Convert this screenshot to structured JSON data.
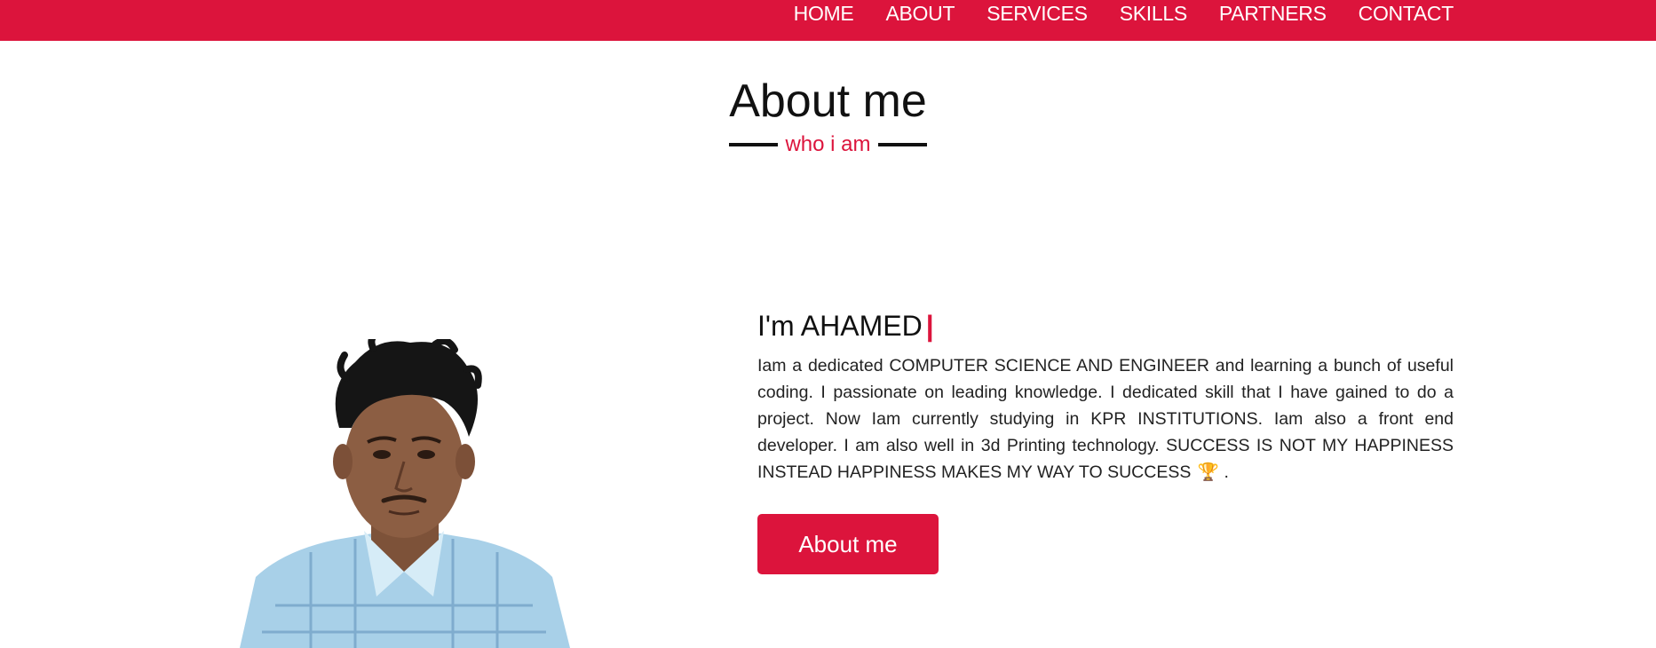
{
  "nav": {
    "items": [
      "HOME",
      "ABOUT",
      "SERVICES",
      "SKILLS",
      "PARTNERS",
      "CONTACT"
    ]
  },
  "section": {
    "title": "About me",
    "subtitle": "who i am"
  },
  "about": {
    "heading": "I'm AHAMED",
    "cursor": "|",
    "paragraph": "Iam a dedicated COMPUTER SCIENCE AND ENGINEER and learning a bunch of useful coding. I passionate on leading knowledge. I dedicated skill that I have gained to do a project. Now Iam currently studying in KPR INSTITUTIONS. Iam also a front end developer. I am also well in 3d Printing technology. SUCCESS IS NOT MY HAPPINESS INSTEAD HAPPINESS MAKES MY WAY TO SUCCESS",
    "trophy": "🏆",
    "ending": ".",
    "button_label": "About me"
  },
  "colors": {
    "accent": "#dc143c",
    "text": "#111111",
    "background": "#ffffff"
  },
  "icons": {
    "photo": "profile-photo",
    "trophy": "trophy-icon"
  }
}
